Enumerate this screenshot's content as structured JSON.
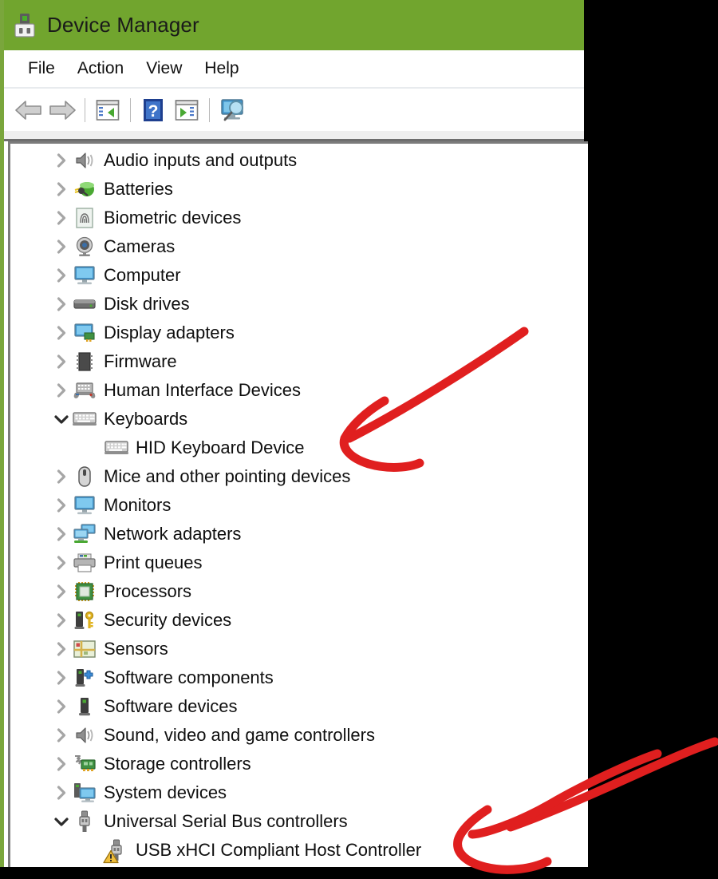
{
  "window": {
    "title": "Device Manager",
    "title_icon": "device-plug-icon",
    "accent_color": "#71a52e"
  },
  "menubar": {
    "items": [
      {
        "label": "File",
        "name": "menu-file"
      },
      {
        "label": "Action",
        "name": "menu-action"
      },
      {
        "label": "View",
        "name": "menu-view"
      },
      {
        "label": "Help",
        "name": "menu-help"
      }
    ]
  },
  "toolbar": {
    "buttons": [
      {
        "name": "back-button",
        "icon": "back-arrow-icon"
      },
      {
        "name": "forward-button",
        "icon": "forward-arrow-icon"
      },
      {
        "sep": true
      },
      {
        "name": "show-console-tree-button",
        "icon": "console-tree-icon"
      },
      {
        "sep": true
      },
      {
        "name": "help-button",
        "icon": "question-mark-icon"
      },
      {
        "name": "properties-button",
        "icon": "properties-icon"
      },
      {
        "sep": true
      },
      {
        "name": "scan-hardware-changes-button",
        "icon": "scan-monitor-icon"
      }
    ]
  },
  "tree": {
    "nodes": [
      {
        "label": "Audio inputs and outputs",
        "icon": "speaker-icon",
        "state": "collapsed",
        "level": 0
      },
      {
        "label": "Batteries",
        "icon": "battery-icon",
        "state": "collapsed",
        "level": 0
      },
      {
        "label": "Biometric devices",
        "icon": "fingerprint-icon",
        "state": "collapsed",
        "level": 0
      },
      {
        "label": "Cameras",
        "icon": "webcam-icon",
        "state": "collapsed",
        "level": 0
      },
      {
        "label": "Computer",
        "icon": "monitor-icon",
        "state": "collapsed",
        "level": 0
      },
      {
        "label": "Disk drives",
        "icon": "disk-drive-icon",
        "state": "collapsed",
        "level": 0
      },
      {
        "label": "Display adapters",
        "icon": "display-adapter-icon",
        "state": "collapsed",
        "level": 0
      },
      {
        "label": "Firmware",
        "icon": "firmware-chip-icon",
        "state": "collapsed",
        "level": 0
      },
      {
        "label": "Human Interface Devices",
        "icon": "hid-gamepad-icon",
        "state": "collapsed",
        "level": 0
      },
      {
        "label": "Keyboards",
        "icon": "keyboard-icon",
        "state": "expanded",
        "level": 0
      },
      {
        "label": "HID Keyboard Device",
        "icon": "keyboard-icon",
        "state": "leaf",
        "level": 1
      },
      {
        "label": "Mice and other pointing devices",
        "icon": "mouse-icon",
        "state": "collapsed",
        "level": 0
      },
      {
        "label": "Monitors",
        "icon": "monitor-icon",
        "state": "collapsed",
        "level": 0
      },
      {
        "label": "Network adapters",
        "icon": "network-adapter-icon",
        "state": "collapsed",
        "level": 0
      },
      {
        "label": "Print queues",
        "icon": "printer-icon",
        "state": "collapsed",
        "level": 0
      },
      {
        "label": "Processors",
        "icon": "processor-icon",
        "state": "collapsed",
        "level": 0
      },
      {
        "label": "Security devices",
        "icon": "security-key-icon",
        "state": "collapsed",
        "level": 0
      },
      {
        "label": "Sensors",
        "icon": "sensor-icon",
        "state": "collapsed",
        "level": 0
      },
      {
        "label": "Software components",
        "icon": "software-component-icon",
        "state": "collapsed",
        "level": 0
      },
      {
        "label": "Software devices",
        "icon": "software-device-icon",
        "state": "collapsed",
        "level": 0
      },
      {
        "label": "Sound, video and game controllers",
        "icon": "speaker-icon",
        "state": "collapsed",
        "level": 0
      },
      {
        "label": "Storage controllers",
        "icon": "storage-controller-icon",
        "state": "collapsed",
        "level": 0
      },
      {
        "label": "System devices",
        "icon": "system-device-icon",
        "state": "collapsed",
        "level": 0
      },
      {
        "label": "Universal Serial Bus controllers",
        "icon": "usb-icon",
        "state": "expanded",
        "level": 0
      },
      {
        "label": "USB xHCI Compliant Host Controller",
        "icon": "usb-icon",
        "state": "leaf",
        "level": 1,
        "warning": true
      }
    ]
  },
  "annotations": {
    "color": "#e01f1f",
    "arrows": [
      {
        "name": "annotation-arrow-keyboard",
        "points_at": "HID Keyboard Device"
      },
      {
        "name": "annotation-arrow-usb-warning",
        "points_at": "USB xHCI Compliant Host Controller"
      }
    ]
  }
}
